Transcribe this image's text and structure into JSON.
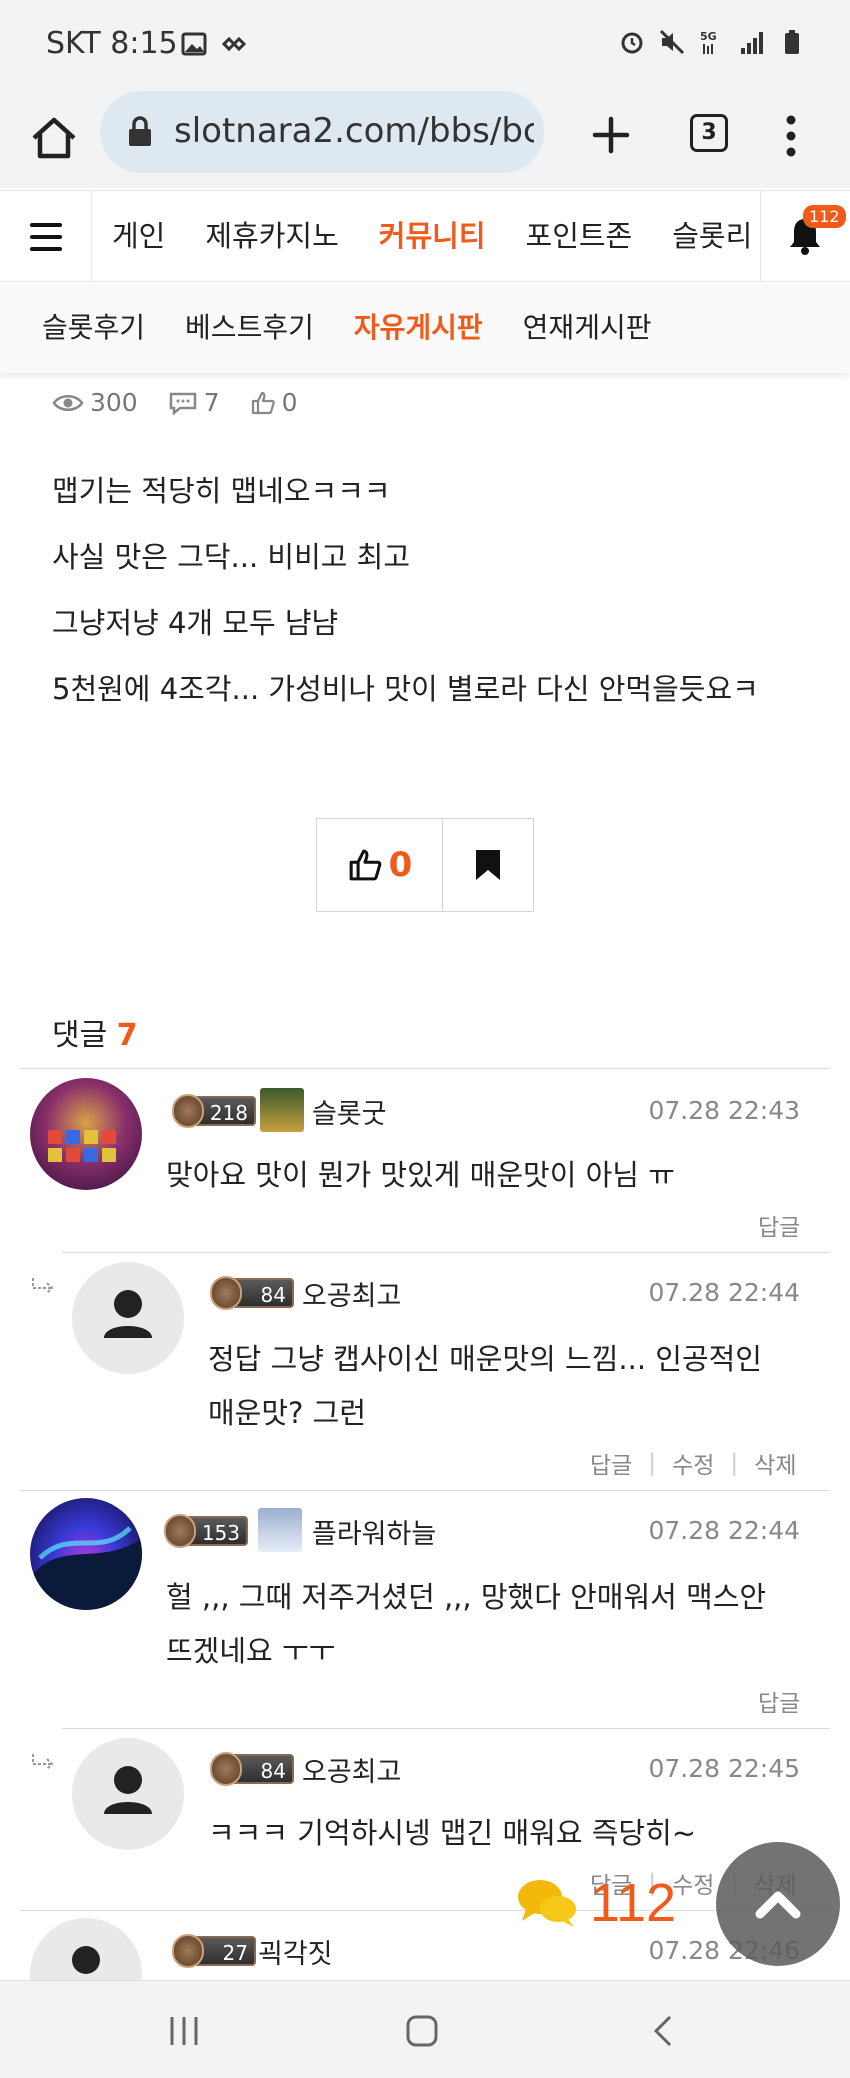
{
  "status_bar": {
    "carrier_time": "SKT 8:15",
    "right_icons": [
      "alarm-icon",
      "mute-icon",
      "5g-icon",
      "signal-icon",
      "battery-icon"
    ]
  },
  "browser": {
    "url": "slotnara2.com/bbs/bc",
    "tab_count": "3"
  },
  "site_nav": {
    "items": [
      "게인",
      "제휴카지노",
      "커뮤니티",
      "포인트존",
      "슬롯리"
    ],
    "active_index": 2,
    "notification_count": "112"
  },
  "sub_nav": {
    "items": [
      "슬롯후기",
      "베스트후기",
      "자유게시판",
      "연재게시판"
    ],
    "active_index": 2
  },
  "post": {
    "views": "300",
    "comments": "7",
    "likes": "0",
    "lines": [
      "맵기는 적당히 맵네오ㅋㅋㅋ",
      "사실 맛은 그닥... 비비고 최고",
      "그냥저냥 4개 모두 냠냠",
      "5천원에 4조각... 가성비나 맛이 별로라 다신 안먹을듯요ㅋ"
    ],
    "like_button_count": "0"
  },
  "comments_section": {
    "label": "댓글",
    "count": "7",
    "comments": [
      {
        "level": "218",
        "name": "슬롯굿",
        "time": "07.28 22:43",
        "text1": "맞아요 맛이 뭔가 맛있게 매운맛이 아님 ㅠ",
        "text2": "",
        "reply_label": "답글"
      },
      {
        "level": "84",
        "name": "오공최고",
        "time": "07.28 22:44",
        "text1": "정답 그냥 캡사이신 매운맛의 느낌... 인공적인",
        "text2": "매운맛? 그런",
        "reply_label": "답글",
        "edit_label": "수정",
        "delete_label": "삭제"
      },
      {
        "level": "153",
        "name": "플라워하늘",
        "time": "07.28 22:44",
        "text1": "헐 ,,, 그때 저주거셨던 ,,, 망했다 안매워서 맥스안",
        "text2": "뜨겠네요 ㅜㅜ",
        "reply_label": "답글"
      },
      {
        "level": "84",
        "name": "오공최고",
        "time": "07.28 22:45",
        "text1": "ㅋㅋㅋ 기억하시넹 맵긴 매워요 즉당히~",
        "text2": "",
        "reply_label": "답글",
        "edit_label": "수정",
        "delete_label": "삭제"
      },
      {
        "level": "27",
        "name": "괵각짓",
        "time": "07.28 22:46",
        "text1": "",
        "text2": ""
      }
    ]
  },
  "floating": {
    "chat_count": "112"
  },
  "colors": {
    "accent": "#f05a1a",
    "browser_bg": "#f1f3f4",
    "url_pill": "#dde8f0"
  }
}
